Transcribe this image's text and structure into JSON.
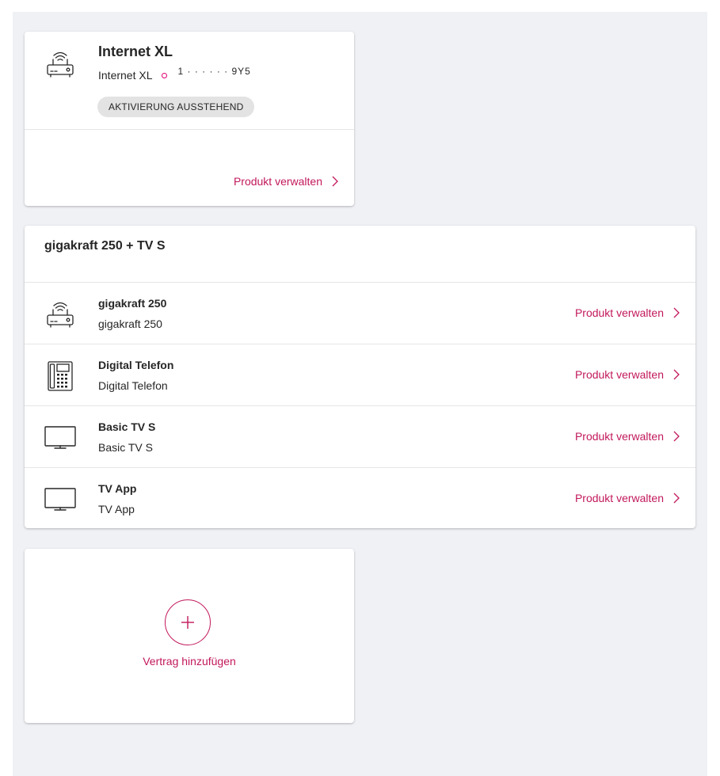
{
  "colors": {
    "accent": "#c2185b",
    "panel_background": "#f0f1f5",
    "card_background": "#ffffff",
    "badge_background": "#e3e3e3",
    "text": "#262626"
  },
  "internet_card": {
    "icon": "router-icon",
    "title": "Internet XL",
    "subtitle": "Internet XL",
    "masked_number": "1  ·  ·  ·  ·  ·  ·  9Y5",
    "status_badge": "AKTIVIERUNG AUSSTEHEND",
    "manage_label": "Produkt verwalten"
  },
  "bundle_card": {
    "title": "gigakraft 250 + TV S",
    "items": [
      {
        "icon": "router-icon",
        "title": "gigakraft 250",
        "subtitle": "gigakraft 250",
        "manage_label": "Produkt verwalten"
      },
      {
        "icon": "desk-phone-icon",
        "title": "Digital Telefon",
        "subtitle": "Digital Telefon",
        "manage_label": "Produkt verwalten"
      },
      {
        "icon": "tv-icon",
        "title": "Basic TV S",
        "subtitle": "Basic TV S",
        "manage_label": "Produkt verwalten"
      },
      {
        "icon": "tv-icon",
        "title": "TV App",
        "subtitle": "TV App",
        "manage_label": "Produkt verwalten"
      }
    ]
  },
  "add_contract": {
    "icon": "plus-icon",
    "label": "Vertrag hinzufügen"
  }
}
